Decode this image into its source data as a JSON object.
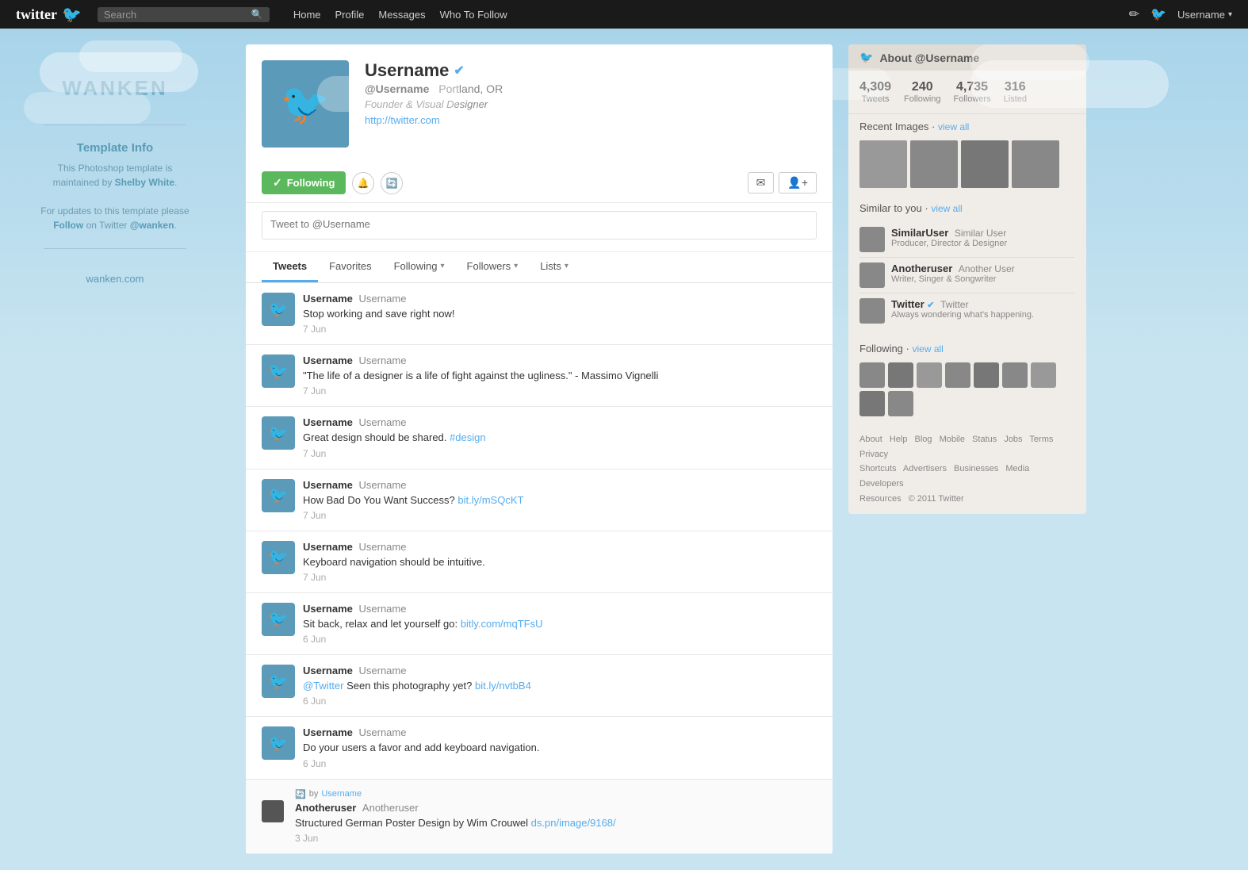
{
  "topnav": {
    "logo": "twitter",
    "bird_char": "🐦",
    "search_placeholder": "Search",
    "links": [
      "Home",
      "Profile",
      "Messages",
      "Who To Follow"
    ],
    "username": "Username",
    "compose_icon": "✏",
    "dropdown_caret": "▾"
  },
  "left_sidebar": {
    "brand": "WANKEN",
    "template_info_title": "Template Info",
    "template_info_line1": "This Photoshop template is",
    "template_info_line2": "maintained by",
    "author_name": "Shelby White",
    "template_info_line3": "For updates to this template please",
    "follow_text": "Follow",
    "on_twitter": " on Twitter ",
    "handle": "@wanken",
    "website": "wanken.com"
  },
  "profile": {
    "username": "Username",
    "handle": "@Username",
    "location": "Portland, OR",
    "bio": "Founder & Visual Designer",
    "website": "http://twitter.com",
    "verified": true,
    "following_label": "Following",
    "tweet_placeholder": "Tweet to @Username"
  },
  "tabs": [
    {
      "label": "Tweets",
      "active": true,
      "has_caret": false
    },
    {
      "label": "Favorites",
      "active": false,
      "has_caret": false
    },
    {
      "label": "Following",
      "active": false,
      "has_caret": true
    },
    {
      "label": "Followers",
      "active": false,
      "has_caret": true
    },
    {
      "label": "Lists",
      "active": false,
      "has_caret": true
    }
  ],
  "tweets": [
    {
      "id": 1,
      "username": "Username",
      "handle": "Username",
      "text": "Stop working and save right now!",
      "date": "7 Jun",
      "is_retweet": false
    },
    {
      "id": 2,
      "username": "Username",
      "handle": "Username",
      "text": "\"The life of a designer is a life of fight against the ugliness.\" - Massimo Vignelli",
      "date": "7 Jun",
      "is_retweet": false
    },
    {
      "id": 3,
      "username": "Username",
      "handle": "Username",
      "text_before": "Great design should be shared. ",
      "link": "#design",
      "link_text": "#design",
      "text_after": "",
      "date": "7 Jun",
      "is_retweet": false,
      "has_link": true
    },
    {
      "id": 4,
      "username": "Username",
      "handle": "Username",
      "text_before": "How Bad Do You Want Success? ",
      "link": "bit.ly/mSQcKT",
      "link_text": "bit.ly/mSQcKT",
      "date": "7 Jun",
      "is_retweet": false,
      "has_link": true
    },
    {
      "id": 5,
      "username": "Username",
      "handle": "Username",
      "text": "Keyboard navigation should be intuitive.",
      "date": "7 Jun",
      "is_retweet": false
    },
    {
      "id": 6,
      "username": "Username",
      "handle": "Username",
      "text_before": "Sit back, relax and let yourself go: ",
      "link": "bitly.com/mqTFsU",
      "link_text": "bitly.com/mqTFsU",
      "date": "6 Jun",
      "is_retweet": false,
      "has_link": true
    },
    {
      "id": 7,
      "username": "Username",
      "handle": "Username",
      "text_before": "",
      "mention": "@Twitter",
      "text_mid": " Seen this photography yet? ",
      "link": "bit.ly/nvtbB4",
      "link_text": "bit.ly/nvtbB4",
      "date": "6 Jun",
      "is_retweet": false,
      "has_mention": true,
      "has_link": true
    },
    {
      "id": 8,
      "username": "Username",
      "handle": "Username",
      "text": "Do your users a favor and add keyboard navigation.",
      "date": "6 Jun",
      "is_retweet": false
    },
    {
      "id": 9,
      "username": "Anotheruser",
      "handle": "Anotheruser",
      "retweeted_by": "Username",
      "text": "Structured German Poster Design by Wim Crouwel",
      "link": "ds.pn/image/9168/",
      "link_text": "ds.pn/image/9168/",
      "date": "3 Jun",
      "is_retweet": true,
      "has_link": true
    }
  ],
  "right_sidebar": {
    "about_label": "About @Username",
    "stats": [
      {
        "num": "4,309",
        "label": "Tweets"
      },
      {
        "num": "240",
        "label": "Following"
      },
      {
        "num": "4,735",
        "label": "Followers"
      },
      {
        "num": "316",
        "label": "Listed"
      }
    ],
    "recent_images_label": "Recent Images",
    "recent_images_link": "view all",
    "similar_label": "Similar to you",
    "similar_link": "view all",
    "similar_users": [
      {
        "name": "SimilarUser",
        "handle": "Similar User",
        "bio": "Producer, Director & Designer",
        "verified": false
      },
      {
        "name": "Anotheruser",
        "handle": "Another User",
        "bio": "Writer, Singer & Songwriter",
        "verified": false
      },
      {
        "name": "Twitter",
        "handle": "Twitter",
        "bio": "Always wondering what's happening.",
        "verified": true
      }
    ],
    "following_label": "Following",
    "following_link": "view all",
    "footer_links": [
      "About",
      "Help",
      "Blog",
      "Mobile",
      "Status",
      "Jobs",
      "Terms",
      "Privacy",
      "Shortcuts",
      "Advertisers",
      "Businesses",
      "Media",
      "Developers",
      "Resources"
    ],
    "copyright": "© 2011 Twitter"
  }
}
